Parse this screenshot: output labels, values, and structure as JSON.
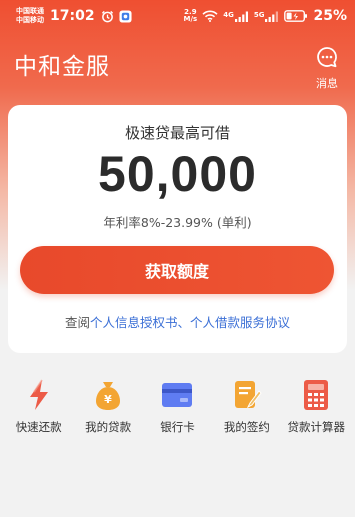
{
  "status_bar": {
    "carrier_1": "中国联通",
    "carrier_2": "中国移动",
    "time": "17:02",
    "net_speed_value": "2.9",
    "net_speed_unit": "M/s",
    "signal_1_tag": "4G",
    "signal_2_tag": "5G",
    "battery": "25%"
  },
  "header": {
    "title": "中和金服",
    "message_label": "消息"
  },
  "card": {
    "subtitle": "极速贷最高可借",
    "amount": "50,000",
    "rate": "年利率8%-23.99% (单利)",
    "button_label": "获取额度",
    "agreement_prefix": "查阅",
    "agreement_link_1": "个人信息授权书",
    "agreement_sep": "、",
    "agreement_link_2": "个人借款服务协议"
  },
  "quick_menu": {
    "items": [
      {
        "label": "快速还款",
        "icon": "lightning-icon"
      },
      {
        "label": "我的贷款",
        "icon": "money-bag-icon"
      },
      {
        "label": "银行卡",
        "icon": "bank-card-icon"
      },
      {
        "label": "我的签约",
        "icon": "contract-icon"
      },
      {
        "label": "贷款计算器",
        "icon": "calculator-icon"
      }
    ]
  },
  "colors": {
    "brand": "#ef4f31",
    "link": "#3b6fd6",
    "icon_orange": "#f3a533",
    "icon_blue": "#5f7cf2",
    "icon_red": "#ec5b47"
  }
}
